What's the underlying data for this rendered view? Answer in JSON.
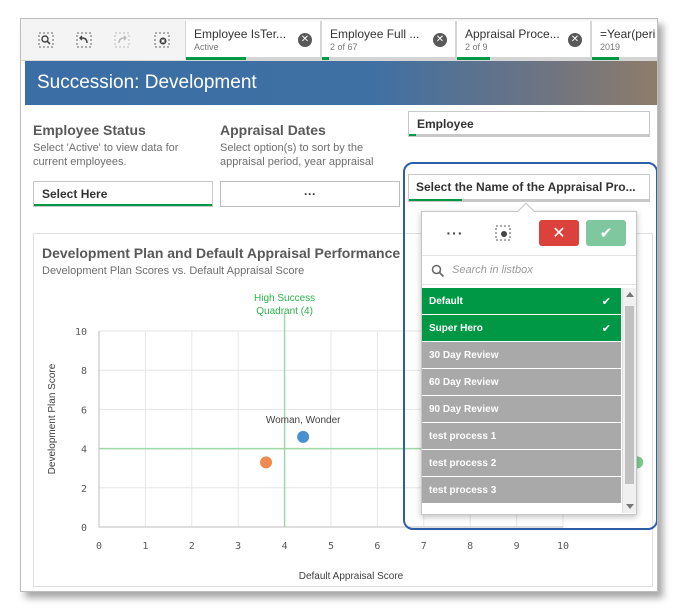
{
  "selection_bar": {
    "tools": [
      {
        "name": "smart-search-icon"
      },
      {
        "name": "step-back-icon"
      },
      {
        "name": "step-forward-icon"
      },
      {
        "name": "clear-all-selections-icon"
      }
    ],
    "chips": [
      {
        "title": "Employee IsTer...",
        "sub": "Active",
        "progress": 0.45
      },
      {
        "title": "Employee Full ...",
        "sub": "2 of 67",
        "progress": 0.05
      },
      {
        "title": "Appraisal Proce...",
        "sub": "2 of 9",
        "progress": 0.25
      },
      {
        "title": "=Year(peri",
        "sub": "2019",
        "progress": 0.4
      }
    ]
  },
  "header": {
    "title": "Succession: Development"
  },
  "filters": {
    "employee_status": {
      "title": "Employee Status",
      "desc": "Select 'Active' to view data for current employees.",
      "button": "Select Here"
    },
    "appraisal_dates": {
      "title": "Appraisal Dates",
      "desc": "Select option(s) to sort by the appraisal period, year appraisal",
      "button": "···"
    },
    "employee": {
      "label": "Employee"
    },
    "appraisal_process": {
      "label": "Select the Name of the Appraisal Pro..."
    }
  },
  "listbox": {
    "more": "···",
    "search_placeholder": "Search in listbox",
    "items": [
      {
        "label": "Default",
        "state": "selected"
      },
      {
        "label": "Super Hero",
        "state": "selected"
      },
      {
        "label": "30 Day Review",
        "state": "alternative"
      },
      {
        "label": "60 Day Review",
        "state": "alternative"
      },
      {
        "label": "90 Day Review",
        "state": "alternative"
      },
      {
        "label": "test process 1",
        "state": "alternative"
      },
      {
        "label": "test process 2",
        "state": "alternative"
      },
      {
        "label": "test process 3",
        "state": "alternative"
      }
    ],
    "check": "✔",
    "colors": {
      "selected": "#009845",
      "alternative": "#a9a9a9",
      "cancel": "#dc423c",
      "confirm": "#7fc79f"
    }
  },
  "chart_data": {
    "type": "scatter",
    "title": "Development Plan and Default Appraisal Performance",
    "subtitle": "Development Plan Scores vs. Default Appraisal Score",
    "xlabel": "Default Appraisal Score",
    "ylabel": "Development Plan Score",
    "xlim": [
      0,
      10
    ],
    "ylim": [
      0,
      10
    ],
    "xticks": [
      "0",
      "1",
      "2",
      "3",
      "4",
      "5",
      "6",
      "7",
      "8",
      "9",
      "10"
    ],
    "yticks": [
      "0",
      "2",
      "4",
      "6",
      "8",
      "10"
    ],
    "reference_lines": {
      "x": 4,
      "y": 4
    },
    "quadrant_label": [
      "High Success",
      "Quadrant (4)"
    ],
    "points": [
      {
        "x": 4.4,
        "y": 4.6,
        "label": "Woman, Wonder",
        "color": "#4a90d0"
      },
      {
        "x": 3.6,
        "y": 3.3,
        "label": "",
        "color": "#ef8a52"
      },
      {
        "x": 11.6,
        "y": 3.3,
        "label": "",
        "color": "#7dcc8f"
      }
    ],
    "grid": true
  }
}
